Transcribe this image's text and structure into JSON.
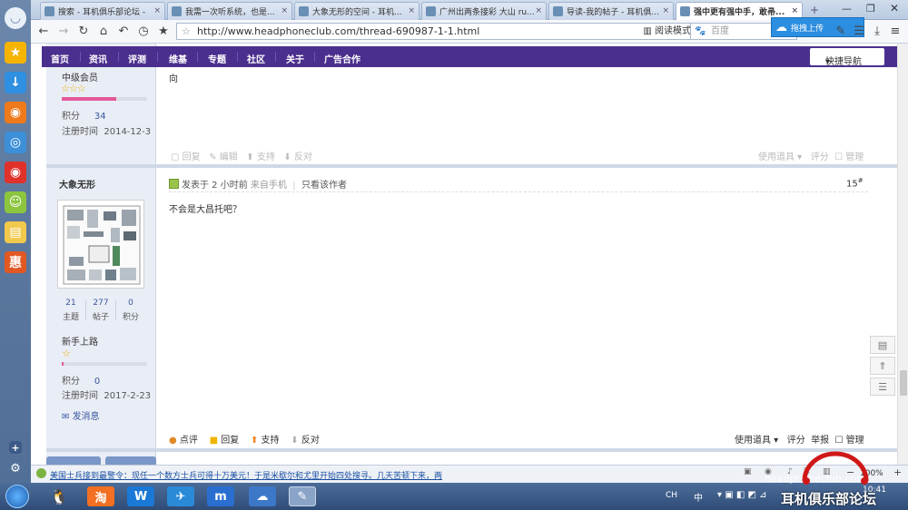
{
  "browser": {
    "tabs": [
      {
        "label": "搜索 - 耳机俱乐部论坛 -",
        "close": "×"
      },
      {
        "label": "我需一次听系统，也是...",
        "close": "×"
      },
      {
        "label": "大象无形的空间 - 耳机...",
        "close": "×"
      },
      {
        "label": "广州出两条接彩 大山 ru...",
        "close": "×"
      },
      {
        "label": "导读-我的帖子 - 耳机俱...",
        "close": "×"
      },
      {
        "label": "强中更有强中手，敢帚...",
        "close": "×"
      }
    ],
    "upload_label": "拖拽上传",
    "url": "http://www.headphoneclub.com/thread-690987-1-1.html",
    "read_mode": "阅读模式",
    "search_placeholder": "百度"
  },
  "site_nav": {
    "items": [
      "首页",
      "资讯",
      "评测",
      "维基",
      "专题",
      "社区",
      "关于",
      "广告合作"
    ],
    "quick_nav": "快捷导航"
  },
  "top_fragment": {
    "line1": "向"
  },
  "user1": {
    "level": "中级会员",
    "points_label": "积分",
    "points": "34",
    "reg_label": "注册时间",
    "reg_date": "2014-12-3"
  },
  "actions1": {
    "reply": "回复",
    "edit": "编辑",
    "support": "支持",
    "oppose": "反对",
    "tools": "使用道具",
    "rate": "评分",
    "manage": "管理"
  },
  "post": {
    "author": "大象无形",
    "stats": [
      {
        "value": "21",
        "label": "主题"
      },
      {
        "value": "277",
        "label": "帖子"
      },
      {
        "value": "0",
        "label": "积分"
      }
    ],
    "level": "新手上路",
    "points_label": "积分",
    "points": "0",
    "reg_label": "注册时间",
    "reg_date": "2017-2-23",
    "message_btn": "发消息",
    "meta": "发表于 2 小时前",
    "source": "来自手机",
    "only_author": "只看该作者",
    "floor": "15",
    "floor_sup": "#",
    "content": "不会是大昌托吧？",
    "actions": {
      "comment": "点评",
      "reply": "回复",
      "support": "支持",
      "oppose": "反对",
      "tools": "使用道具",
      "rate": "评分",
      "report": "举报",
      "manage": "管理"
    }
  },
  "statusbar": {
    "news": "美国士兵接到最警令：现任一个数方士兵可得十万美元！于是米歇尔和尤里开始四处搜寻。几天苦顿下来，两",
    "zoom": "100%"
  },
  "taskbar": {
    "ime": "CH",
    "lang": "中",
    "time": "10:41",
    "watermark": "耳机俱乐部论坛",
    "watermark_url": "headphoneclub.com"
  },
  "colors": {
    "nav_bg": "#4b2f8e",
    "sidebar": "#6c88ad",
    "link": "#3a56a0"
  }
}
